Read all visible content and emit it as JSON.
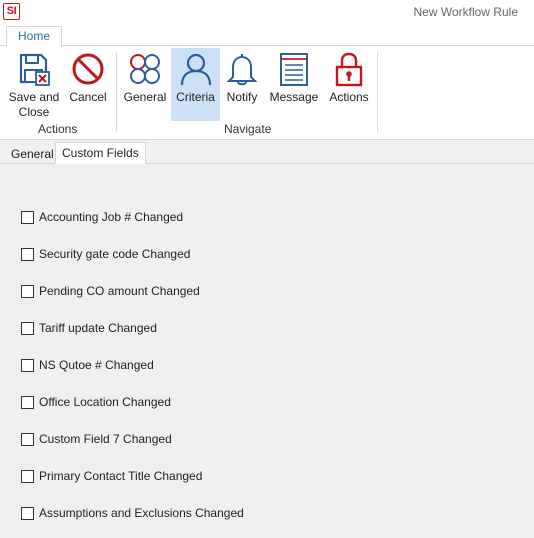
{
  "app": {
    "logo_text": "SI",
    "window_title": "New Workflow Rule"
  },
  "ribbon": {
    "tabs": [
      {
        "label": "Home"
      }
    ],
    "buttons": {
      "save_and_close": "Save and\nClose",
      "cancel": "Cancel",
      "general": "General",
      "criteria": "Criteria",
      "notify": "Notify",
      "message": "Message",
      "actions": "Actions"
    },
    "selected_button": "criteria",
    "groups": {
      "actions": "Actions",
      "navigate": "Navigate"
    }
  },
  "content_tabs": [
    {
      "label": "General"
    },
    {
      "label": "Custom Fields"
    }
  ],
  "active_content_tab": "Custom Fields",
  "custom_fields": [
    {
      "label": "Accounting Job # Changed",
      "checked": false
    },
    {
      "label": "Security gate code Changed",
      "checked": false
    },
    {
      "label": "Pending CO amount Changed",
      "checked": false
    },
    {
      "label": "Tariff update Changed",
      "checked": false
    },
    {
      "label": "NS Qutoe # Changed",
      "checked": false
    },
    {
      "label": "Office Location Changed",
      "checked": false
    },
    {
      "label": "Custom Field 7 Changed",
      "checked": false
    },
    {
      "label": "Primary Contact Title Changed",
      "checked": false
    },
    {
      "label": "Assumptions and Exclusions Changed",
      "checked": false
    }
  ],
  "colors": {
    "brand_red": "#c0161c",
    "icon_blue": "#2b5f9e",
    "selected_bg": "#cde0f4",
    "panel_bg": "#f0f0f0"
  }
}
